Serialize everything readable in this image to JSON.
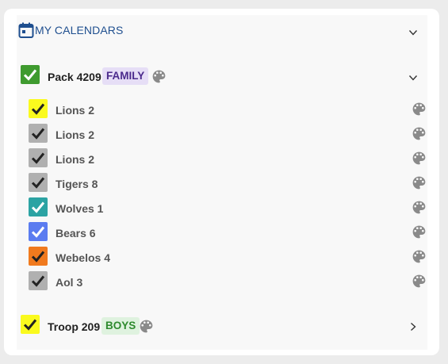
{
  "header": {
    "title": "MY CALENDARS",
    "icon": "calendar-icon",
    "accent": "#1f4f8f"
  },
  "groups": [
    {
      "name": "Pack 4209",
      "badge": "FAMILY",
      "badge_color": "#4b2a8c",
      "badge_bg": "#e6def6",
      "checkbox_color": "#3f9b2f",
      "checked": true,
      "expanded": true,
      "calendars": [
        {
          "label": "Lions 2",
          "color": "#fafa1e",
          "checked": true
        },
        {
          "label": "Lions 2",
          "color": "#b0b0b0",
          "checked": true
        },
        {
          "label": "Lions 2",
          "color": "#b0b0b0",
          "checked": true
        },
        {
          "label": "Tigers 8",
          "color": "#b0b0b0",
          "checked": true
        },
        {
          "label": "Wolves 1",
          "color": "#2ca3a3",
          "checked": true
        },
        {
          "label": "Bears 6",
          "color": "#5b7cf0",
          "checked": true
        },
        {
          "label": "Webelos 4",
          "color": "#f07a1e",
          "checked": true
        },
        {
          "label": "Aol 3",
          "color": "#b0b0b0",
          "checked": true
        }
      ]
    },
    {
      "name": "Troop 209",
      "badge": "BOYS",
      "badge_color": "#2d8a2d",
      "badge_bg": "#dff2df",
      "checkbox_color": "#fafa1e",
      "checked": true,
      "expanded": false,
      "calendars": []
    }
  ]
}
